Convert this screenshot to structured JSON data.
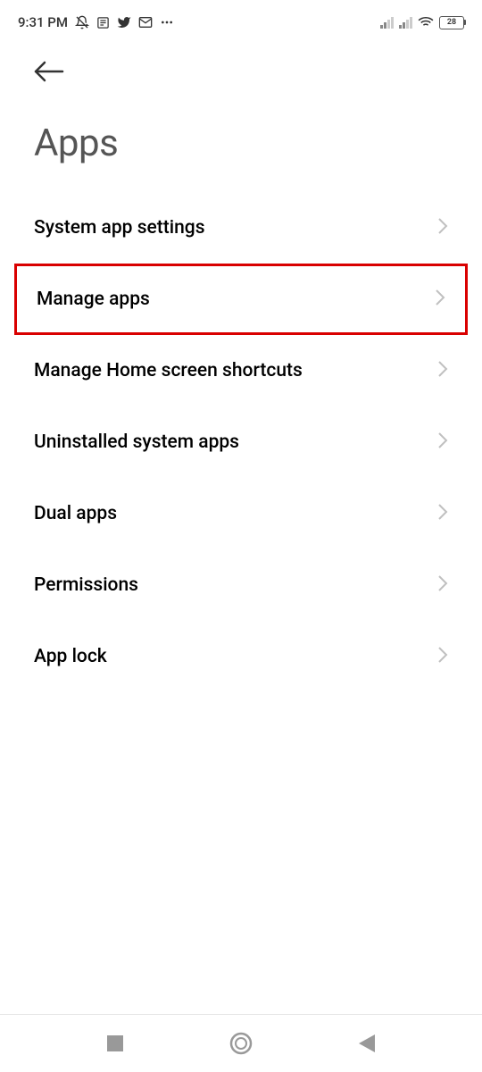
{
  "status": {
    "time": "9:31 PM",
    "battery": "28"
  },
  "page": {
    "title": "Apps"
  },
  "menu": {
    "items": [
      {
        "label": "System app settings"
      },
      {
        "label": "Manage apps"
      },
      {
        "label": "Manage Home screen shortcuts"
      },
      {
        "label": "Uninstalled system apps"
      },
      {
        "label": "Dual apps"
      },
      {
        "label": "Permissions"
      },
      {
        "label": "App lock"
      }
    ],
    "highlighted_index": 1
  }
}
